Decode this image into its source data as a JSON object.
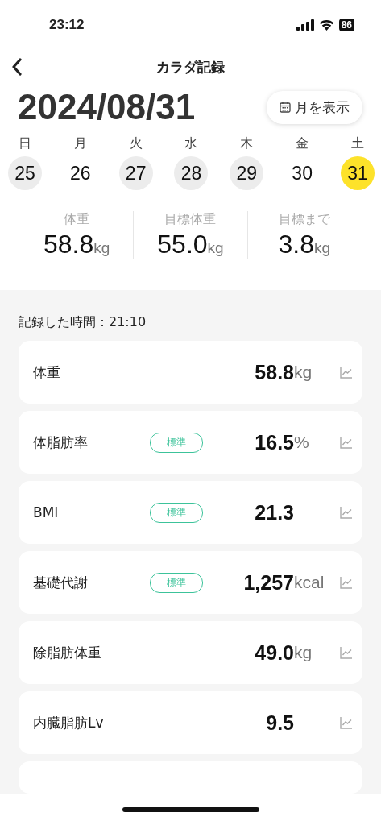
{
  "status_bar": {
    "time": "23:12",
    "battery": "86"
  },
  "header": {
    "title": "カラダ記録"
  },
  "date": "2024/08/31",
  "month_button": {
    "label": "月を表示"
  },
  "week": [
    {
      "weekday": "日",
      "day": "25",
      "recorded": true,
      "selected": false
    },
    {
      "weekday": "月",
      "day": "26",
      "recorded": false,
      "selected": false
    },
    {
      "weekday": "火",
      "day": "27",
      "recorded": true,
      "selected": false
    },
    {
      "weekday": "水",
      "day": "28",
      "recorded": true,
      "selected": false
    },
    {
      "weekday": "木",
      "day": "29",
      "recorded": true,
      "selected": false
    },
    {
      "weekday": "金",
      "day": "30",
      "recorded": false,
      "selected": false
    },
    {
      "weekday": "土",
      "day": "31",
      "recorded": false,
      "selected": true
    }
  ],
  "summary": [
    {
      "label": "体重",
      "value": "58.8",
      "unit": "kg"
    },
    {
      "label": "目標体重",
      "value": "55.0",
      "unit": "kg"
    },
    {
      "label": "目標まで",
      "value": "3.8",
      "unit": "kg"
    }
  ],
  "record_time": "記録した時間：21:10",
  "metrics": [
    {
      "name": "体重",
      "value": "58.8",
      "unit": "kg"
    },
    {
      "name": "体脂肪率",
      "badge": "標準",
      "value": "16.5",
      "unit": "%"
    },
    {
      "name": "BMI",
      "badge": "標準",
      "value": "21.3"
    },
    {
      "name": "基礎代謝",
      "badge": "標準",
      "value": "1,257",
      "unit": "kcal"
    },
    {
      "name": "除脂肪体重",
      "value": "49.0",
      "unit": "kg"
    },
    {
      "name": "内臓脂肪Lv",
      "value": "9.5"
    }
  ]
}
